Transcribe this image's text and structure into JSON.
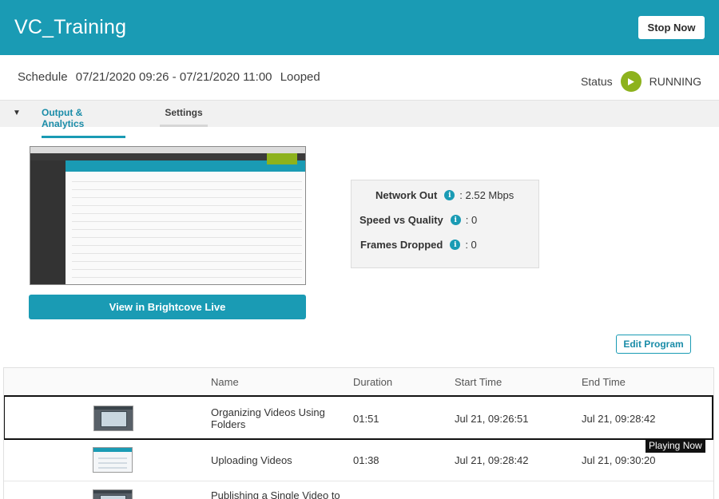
{
  "header": {
    "title": "VC_Training",
    "stop_label": "Stop Now"
  },
  "schedule": {
    "label": "Schedule",
    "range": "07/21/2020 09:26 - 07/21/2020 11:00",
    "mode": "Looped"
  },
  "status": {
    "label": "Status",
    "value": "RUNNING",
    "icon": "play-icon",
    "color": "#8db21d"
  },
  "tabs": {
    "toggle_icon": "caret-down-icon",
    "items": [
      {
        "label": "Output & Analytics",
        "active": true
      },
      {
        "label": "Settings",
        "active": false
      }
    ]
  },
  "preview": {
    "button_label": "View in Brightcove Live"
  },
  "stats": [
    {
      "label": "Network Out",
      "value": ": 2.52 Mbps"
    },
    {
      "label": "Speed vs Quality",
      "value": ": 0"
    },
    {
      "label": "Frames Dropped",
      "value": ": 0"
    }
  ],
  "edit_label": "Edit Program",
  "table": {
    "columns": [
      "Name",
      "Duration",
      "Start Time",
      "End Time"
    ],
    "rows": [
      {
        "name": "Organizing Videos Using Folders",
        "duration": "01:51",
        "start": "Jul 21, 09:26:51",
        "end": "Jul 21, 09:28:42"
      },
      {
        "name": "Uploading Videos",
        "duration": "01:38",
        "start": "Jul 21, 09:28:42",
        "end": "Jul 21, 09:30:20"
      },
      {
        "name": "Publishing a Single Video to",
        "duration": "",
        "start": "",
        "end": ""
      }
    ],
    "playing_badge": "Playing Now"
  },
  "colors": {
    "brand": "#1a9bb4",
    "status_green": "#8db21d"
  }
}
